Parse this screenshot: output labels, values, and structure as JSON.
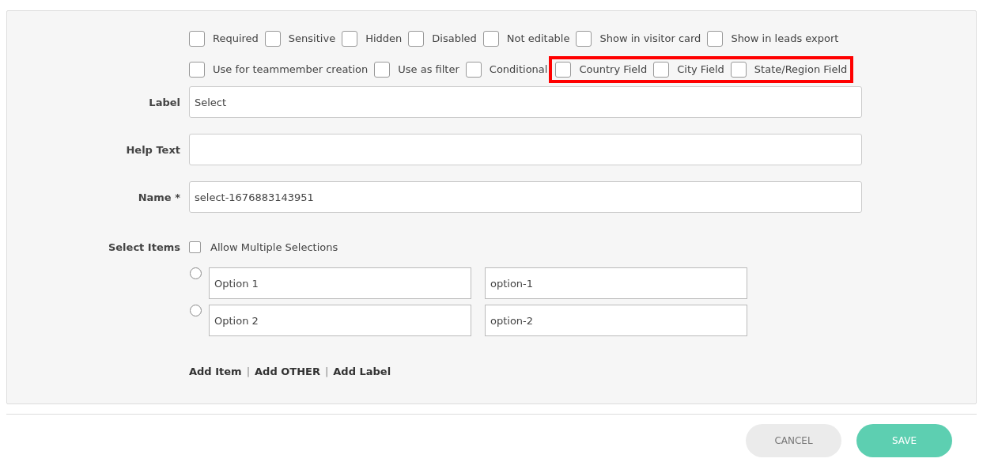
{
  "flags": {
    "row_1": [
      {
        "label": "Required",
        "checked": false
      },
      {
        "label": "Sensitive",
        "checked": false
      },
      {
        "label": "Hidden",
        "checked": false
      },
      {
        "label": "Disabled",
        "checked": false
      },
      {
        "label": "Not editable",
        "checked": false
      },
      {
        "label": "Show in visitor card",
        "checked": false
      },
      {
        "label": "Show in leads export",
        "checked": false
      }
    ],
    "row_2": [
      {
        "label": "Use for teammember creation",
        "checked": false
      },
      {
        "label": "Use as filter",
        "checked": false
      },
      {
        "label": "Conditional",
        "checked": false
      }
    ],
    "row_2_highlighted": [
      {
        "label": "Country Field",
        "checked": false
      },
      {
        "label": "City Field",
        "checked": false
      },
      {
        "label": "State/Region Field",
        "checked": false
      }
    ]
  },
  "fields": [
    {
      "label": "Label",
      "value": "Select"
    },
    {
      "label": "Help Text"
    },
    {
      "label": "Name *",
      "value": "select-1676883143951"
    }
  ],
  "select_items": {
    "label": "Select Items",
    "allow_multiple": {
      "label": "Allow Multiple Selections",
      "checked": false
    },
    "options": [
      {
        "text": "Option 1",
        "value": "option-1",
        "selected": false
      },
      {
        "text": "Option 2",
        "value": "option-2",
        "selected": false
      }
    ]
  },
  "links": [
    {
      "text": "Add Item"
    },
    {
      "separator": "|",
      "text": "Add OTHER"
    },
    {
      "separator": "|",
      "text": "Add Label"
    }
  ],
  "buttons": [
    {
      "label": "CANCEL",
      "kind": "secondary"
    },
    {
      "label": "SAVE",
      "kind": "primary"
    }
  ]
}
